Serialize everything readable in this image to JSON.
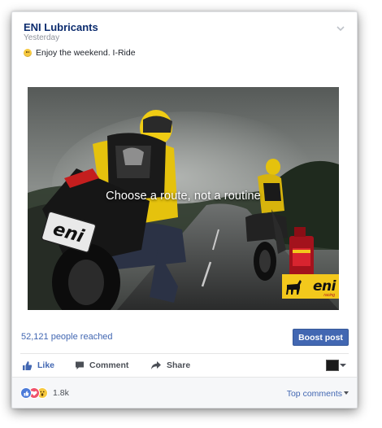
{
  "post": {
    "page_name": "ENI Lubricants",
    "timestamp": "Yesterday",
    "text": "Enjoy the weekend. I-Ride"
  },
  "image": {
    "caption": "Choose a route, not a routine",
    "brand_word": "eni",
    "brand_sub": "racing",
    "plate_text": "eni"
  },
  "stats": {
    "reach": "52,121 people reached",
    "boost_label": "Boost post"
  },
  "actions": {
    "like": "Like",
    "comment": "Comment",
    "share": "Share"
  },
  "footer": {
    "reaction_count": "1.8k",
    "top_comments": "Top comments"
  },
  "icons": {
    "options": "chevron-down-icon",
    "like": "thumbs-up-icon",
    "comment": "speech-bubble-icon",
    "share": "share-arrow-icon",
    "audience": "page-avatar-icon",
    "reactions": [
      "like-reaction-icon",
      "love-reaction-icon",
      "wow-reaction-icon"
    ]
  },
  "colors": {
    "link_blue": "#4267b2",
    "title_navy": "#0c2c6e",
    "brand_yellow": "#f3c81c",
    "jacket_yellow": "#e5c20d"
  }
}
